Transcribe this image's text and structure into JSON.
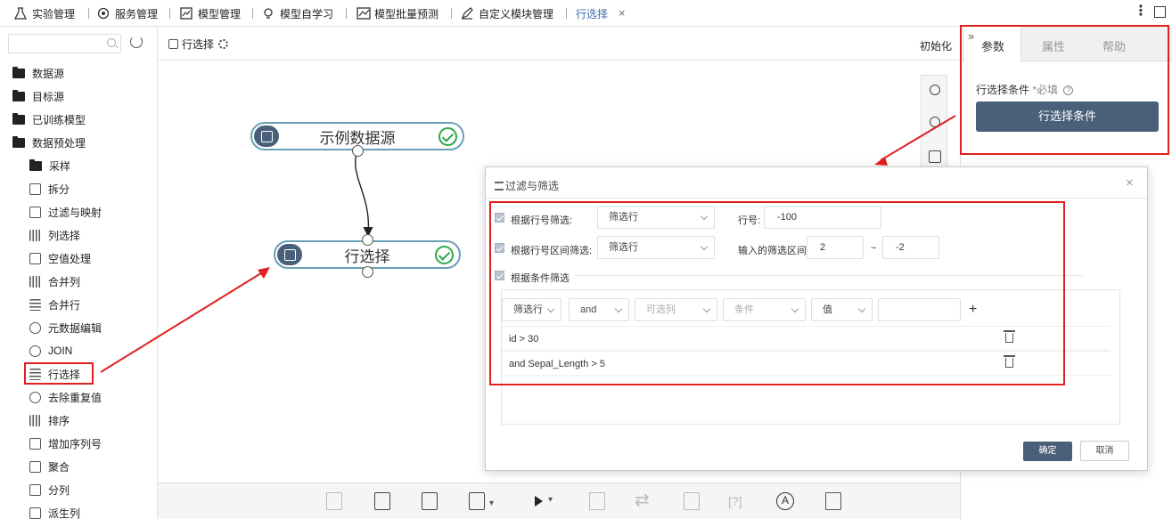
{
  "topbar": {
    "menus": [
      {
        "label": "实验管理",
        "icon": "flask-icon"
      },
      {
        "label": "服务管理",
        "icon": "service-icon"
      },
      {
        "label": "模型管理",
        "icon": "chart-icon"
      },
      {
        "label": "模型自学习",
        "icon": "bulb-icon"
      },
      {
        "label": "模型批量预测",
        "icon": "trend-icon"
      },
      {
        "label": "自定义模块管理",
        "icon": "edit-icon"
      }
    ],
    "active_tab": "行选择",
    "close": "×",
    "kebab": "⋮"
  },
  "sidebar": {
    "search_placeholder": "",
    "folders": [
      "数据源",
      "目标源",
      "已训练模型",
      "数据预处理"
    ],
    "tools": [
      "采样",
      "拆分",
      "过滤与映射",
      "列选择",
      "空值处理",
      "合并列",
      "合并行",
      "元数据编辑",
      "JOIN",
      "行选择",
      "去除重复值",
      "排序",
      "增加序列号",
      "聚合",
      "分列",
      "派生列"
    ]
  },
  "canvas": {
    "title": "行选择",
    "reset_label": "初始化",
    "nodes": [
      {
        "label": "示例数据源",
        "status": "success"
      },
      {
        "label": "行选择",
        "status": "success"
      }
    ]
  },
  "bottom_toolbar": {
    "help_label": "[?]",
    "auto_label": "A"
  },
  "right_panel": {
    "expand": "»",
    "tabs": [
      "参数",
      "属性",
      "帮助"
    ],
    "field_label": "行选择条件",
    "required": "*必填",
    "help": "?",
    "button_label": "行选择条件"
  },
  "dialog": {
    "title": "过滤与筛选",
    "close": "×",
    "row1": {
      "label": "根据行号筛选:",
      "select": "筛选行",
      "num_label": "行号:",
      "value": "-100"
    },
    "row2": {
      "label": "根据行号区间筛选:",
      "select": "筛选行",
      "range_label": "输入的筛选区间:",
      "from": "2",
      "tilde": "~",
      "to": "-2"
    },
    "row3": {
      "label": "根据条件筛选"
    },
    "builder": {
      "filter_select": "筛选行",
      "logic_select": "and",
      "column_select": "可选列",
      "condition_select": "条件",
      "value_select": "值",
      "value_input": "",
      "add": "+"
    },
    "conditions": [
      "id > 30",
      "and Sepal_Length > 5"
    ],
    "ok_label": "确定",
    "cancel_label": "取消"
  },
  "colors": {
    "accent": "#4a5f79",
    "highlight": "#e02020",
    "success": "#2aa84a",
    "node_border": "#6a9fb8"
  }
}
